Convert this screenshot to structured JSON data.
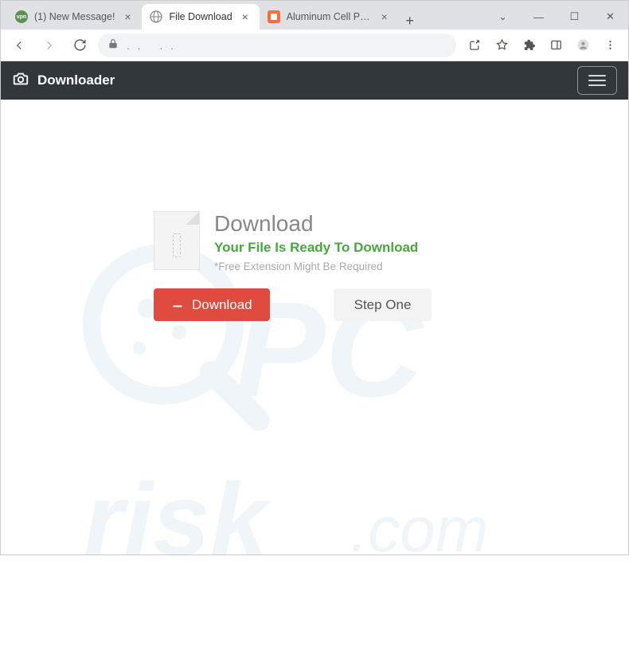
{
  "tabs": [
    {
      "title": "(1) New Message!",
      "favicon_text": "vpn",
      "favicon_bg": "#5f8f4e",
      "favicon_color": "#fff"
    },
    {
      "title": "File Download",
      "favicon_svg": "globe"
    },
    {
      "title": "Aluminum Cell Phone H",
      "favicon_text": "",
      "favicon_bg": "#ff6d33",
      "favicon_shape": "square"
    }
  ],
  "active_tab_index": 1,
  "omnibox": {
    "value": ". .   . ."
  },
  "header": {
    "brand": "Downloader"
  },
  "download": {
    "title": "Download",
    "ready_text": "Your File Is Ready To Download",
    "disclaimer": "*Free Extension Might Be Required",
    "button_label": "Download",
    "step_label": "Step One"
  }
}
